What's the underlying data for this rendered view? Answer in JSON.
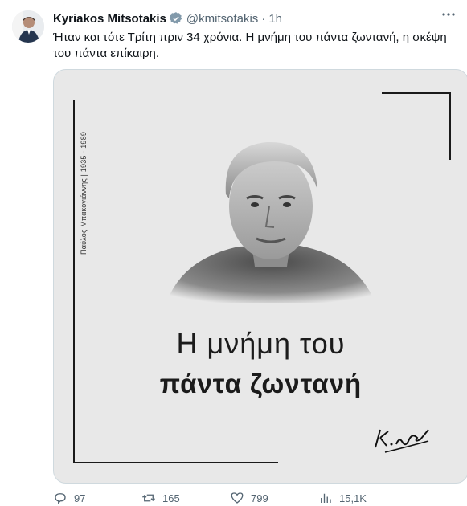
{
  "author": {
    "name": "Kyriakos Mitsotakis",
    "handle": "@kmitsotakis",
    "separator": "·",
    "time": "1h"
  },
  "tweet": {
    "text": "Ήταν και τότε Τρίτη πριν 34 χρόνια. Η μνήμη του πάντα ζωντανή, η σκέψη του πάντα επίκαιρη."
  },
  "media": {
    "vertical_caption": "Παύλος Μπακογιάννης | 1935 - 1989",
    "headline_line1": "Η μνήμη του",
    "headline_line2": "πάντα ζωντανή"
  },
  "actions": {
    "replies": "97",
    "retweets": "165",
    "likes": "799",
    "views": "15,1K"
  },
  "colors": {
    "verified": "#829aab",
    "secondary_text": "#536471",
    "media_background": "#e8e8e8"
  }
}
